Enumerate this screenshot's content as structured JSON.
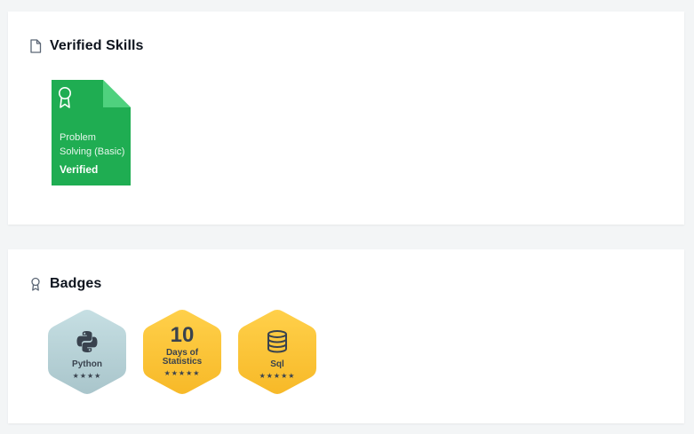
{
  "verified_skills": {
    "title": "Verified Skills",
    "certificate": {
      "name": "Problem Solving (Basic)",
      "status": "Verified",
      "color": "#1fad52"
    }
  },
  "badges": {
    "title": "Badges",
    "items": [
      {
        "icon": "python-logo-icon",
        "label": "Python",
        "stars": "★★★★",
        "star_count": 4,
        "color": "#b9d4d9"
      },
      {
        "number": "10",
        "label_line1": "Days of",
        "label_line2": "Statistics",
        "stars": "★★★★★",
        "star_count": 5,
        "color": "#ffc332"
      },
      {
        "icon": "database-icon",
        "label": "Sql",
        "stars": "★★★★★",
        "star_count": 5,
        "color": "#ffc332"
      }
    ]
  }
}
